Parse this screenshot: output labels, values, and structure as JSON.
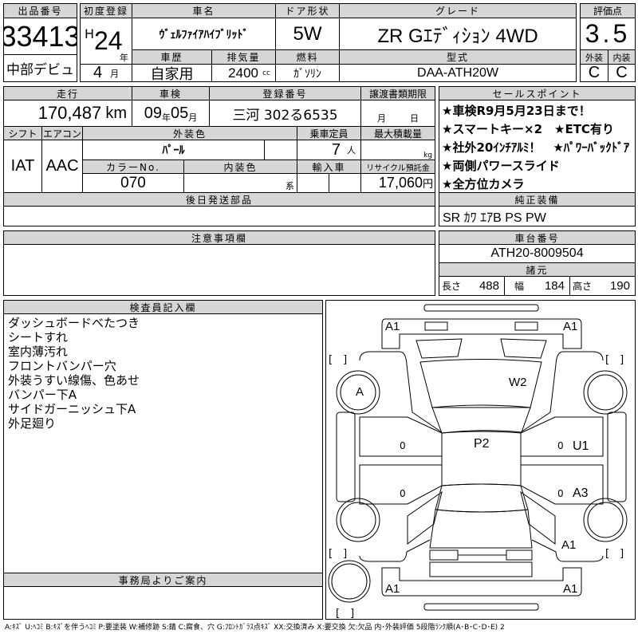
{
  "lot": {
    "label": "出品番号",
    "number": "33413",
    "auction": "中部デビュ"
  },
  "first_reg": {
    "label": "初度登録",
    "era": "H",
    "year": "24",
    "year_unit": "年",
    "month": "4",
    "month_unit": "月"
  },
  "car_name": {
    "label": "車名",
    "value": "ｳﾞｪﾙﾌｧｲｱﾊｲﾌﾞﾘｯﾄﾞ"
  },
  "door": {
    "label": "ドア形状",
    "value": "5W"
  },
  "grade": {
    "label": "グレード",
    "value": "ZR Gｴﾃﾞｨｼｮﾝ 4WD"
  },
  "score": {
    "label": "評価点",
    "value": "3.5",
    "ext_label": "外装",
    "int_label": "内装",
    "ext": "C",
    "int": "C"
  },
  "history": {
    "label": "車歴",
    "value": "自家用"
  },
  "displacement": {
    "label": "排気量",
    "value": "2400",
    "unit": "cc"
  },
  "fuel": {
    "label": "燃料",
    "value": "ｶﾞｿﾘﾝ"
  },
  "model": {
    "label": "型式",
    "value": "DAA-ATH20W"
  },
  "mileage": {
    "label": "走行",
    "value": "170,487",
    "unit": "km"
  },
  "inspection": {
    "label": "車検",
    "year": "09",
    "year_unit": "年",
    "month": "05",
    "month_unit": "月"
  },
  "registration": {
    "label": "登録番号",
    "value": "三河 302る6535"
  },
  "transfer": {
    "label": "譲渡書類期限",
    "month_unit": "月",
    "day_unit": "日"
  },
  "shift": {
    "label": "シフト",
    "value": "IAT"
  },
  "ac": {
    "label": "エアコン",
    "value": "AAC"
  },
  "ext_color": {
    "label": "外装色",
    "value": "ﾊﾟｰﾙ"
  },
  "capacity": {
    "label": "乗車定員",
    "value": "7",
    "unit": "人"
  },
  "max_load": {
    "label": "最大積載量",
    "unit": "kg"
  },
  "color_no": {
    "label": "カラーNo.",
    "value": "070"
  },
  "int_color": {
    "label": "内装色",
    "unit": "系"
  },
  "import": {
    "label": "輸入車"
  },
  "recycle": {
    "label": "リサイクル預託金",
    "value": "17,060",
    "unit": "円"
  },
  "later_parts": {
    "label": "後日発送部品"
  },
  "sales_points": {
    "label": "セールスポイント",
    "items": [
      "★車検R9月5月23日まで！",
      "★スマートキー×2　★ETC有り",
      "★社外20ｲﾝﾁｱﾙﾐ！　★ﾊﾟﾜｰﾊﾞｯｸﾄﾞｱ",
      "★両側パワースライド",
      "★全方位カメラ"
    ]
  },
  "equipment": {
    "label": "純正装備",
    "value": "SR ｶﾜ ｴｱB PS PW"
  },
  "caution": {
    "label": "注意事項欄"
  },
  "chassis": {
    "label": "車台番号",
    "value": "ATH20-8009504"
  },
  "specs": {
    "label": "諸元",
    "length_label": "長さ",
    "length": "488",
    "width_label": "幅",
    "width": "184",
    "height_label": "高さ",
    "height": "190"
  },
  "inspector": {
    "label": "検査員記入欄",
    "notes": [
      "ダッシュボードべたつき",
      "シートすれ",
      "室内薄汚れ",
      "フロントバンパー穴",
      "外装うすい線傷、色あせ",
      "バンパー下A",
      "サイドガーニッシュ下A",
      "外足廻り"
    ]
  },
  "office": {
    "label": "事務局よりご案内"
  },
  "diagram": {
    "marks": {
      "front_left_bumper": "A1",
      "front_right_bumper": "A1",
      "front_left_wheel": "A",
      "hood": "W2",
      "roof": "P2",
      "right_front_door": "U1",
      "right_rear_door": "A3",
      "right_rear_fender": "A1",
      "rear_left_bumper": "A1",
      "rear_right_bumper": "A1"
    },
    "door_zero": "0",
    "bracket": "[　]"
  },
  "legend": "A:ｷｽﾞ U:ﾍｺﾐ B:ｷｽﾞを伴うﾍｺﾐ P:要塗装 W:補修跡 S:錆 C:腐食、穴 G:ﾌﾛﾝﾄｶﾞﾗｽ点ｷｽﾞ XX:交換済み X:要交換 欠:欠品 内･外装評価 5段階ﾗﾝｸ順(A･B･C･D･E) 2"
}
